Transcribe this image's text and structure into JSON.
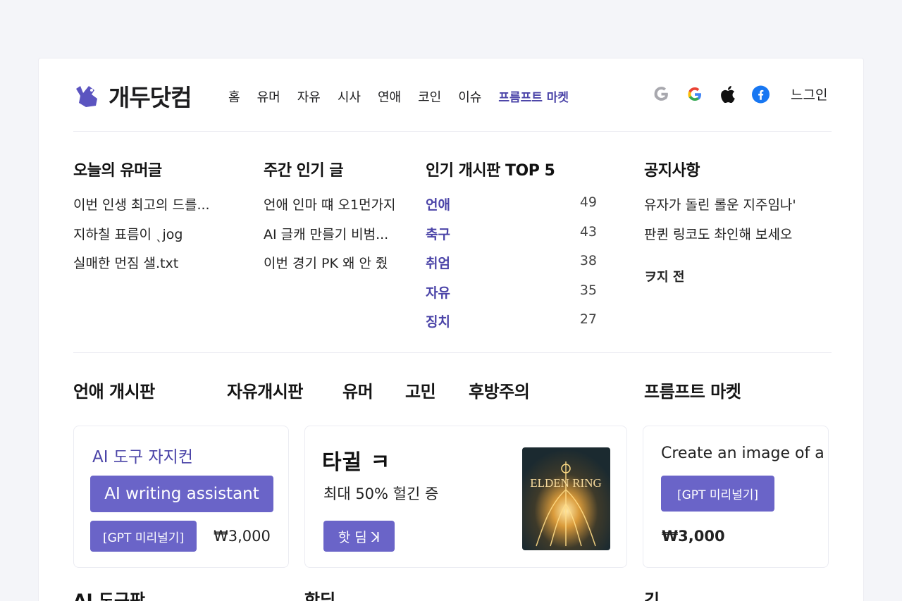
{
  "header": {
    "logo_text": "개두닷컴",
    "nav": [
      "홈",
      "유머",
      "자유",
      "시사",
      "연애",
      "코인",
      "이슈"
    ],
    "nav_accent": "프름프트 마켓",
    "social_icons": [
      "google-gray-icon",
      "google-color-icon",
      "apple-icon",
      "facebook-icon"
    ],
    "login_label": "느그인"
  },
  "colors": {
    "accent": "#4b44a8",
    "button": "#6a64c8",
    "background": "#f4f5f9"
  },
  "humor": {
    "title": "오늘의 유머글",
    "items": [
      "이번 인생 최고의 드를...",
      "지하칠 표름이 ˎjog",
      "실매한 먼짐 샐.txt"
    ]
  },
  "weekly": {
    "title": "주간 인기 글",
    "items": [
      "언애 인마 떄 오1먼가지",
      "AI 글캐 만를기 비범...",
      "이번 경기 PK 왜 안 줬"
    ]
  },
  "top5": {
    "title": "인기 개시판 TOP 5",
    "boards": [
      {
        "name": "언애",
        "count": "49"
      },
      {
        "name": "축구",
        "count": "43"
      },
      {
        "name": "취엄",
        "count": "38"
      },
      {
        "name": "자유",
        "count": "35"
      },
      {
        "name": "징치",
        "count": "27"
      }
    ]
  },
  "notice": {
    "title": "공지사항",
    "items": [
      "유자가 돌린 롤운 지주임나'",
      "판퀸 링코도 촤인해 보세오"
    ],
    "time": "ヲ지 전"
  },
  "section_tabs": {
    "left": "언애 개시판",
    "middle": [
      "자유개시판",
      "유머",
      "고민",
      "후방주의"
    ],
    "right": "프름프트 마켓"
  },
  "card1": {
    "title": "AI 도구 자지컨",
    "main_button": "AI writing assistant",
    "gpt_button": "[GPT 미리널기]",
    "price": "₩3,000"
  },
  "card2": {
    "title": "타귈 ㅋ",
    "subtitle": "최대 50% 헐긴 증",
    "button": "핫 딤 ꓘ",
    "image_text": "ELDEN RING"
  },
  "card3": {
    "title": "Create an image of a",
    "gpt_button": "[GPT 미리널기]",
    "price": "₩3,000"
  },
  "bottom_heads": [
    "AI 도구판",
    "핫딤",
    "긴"
  ]
}
